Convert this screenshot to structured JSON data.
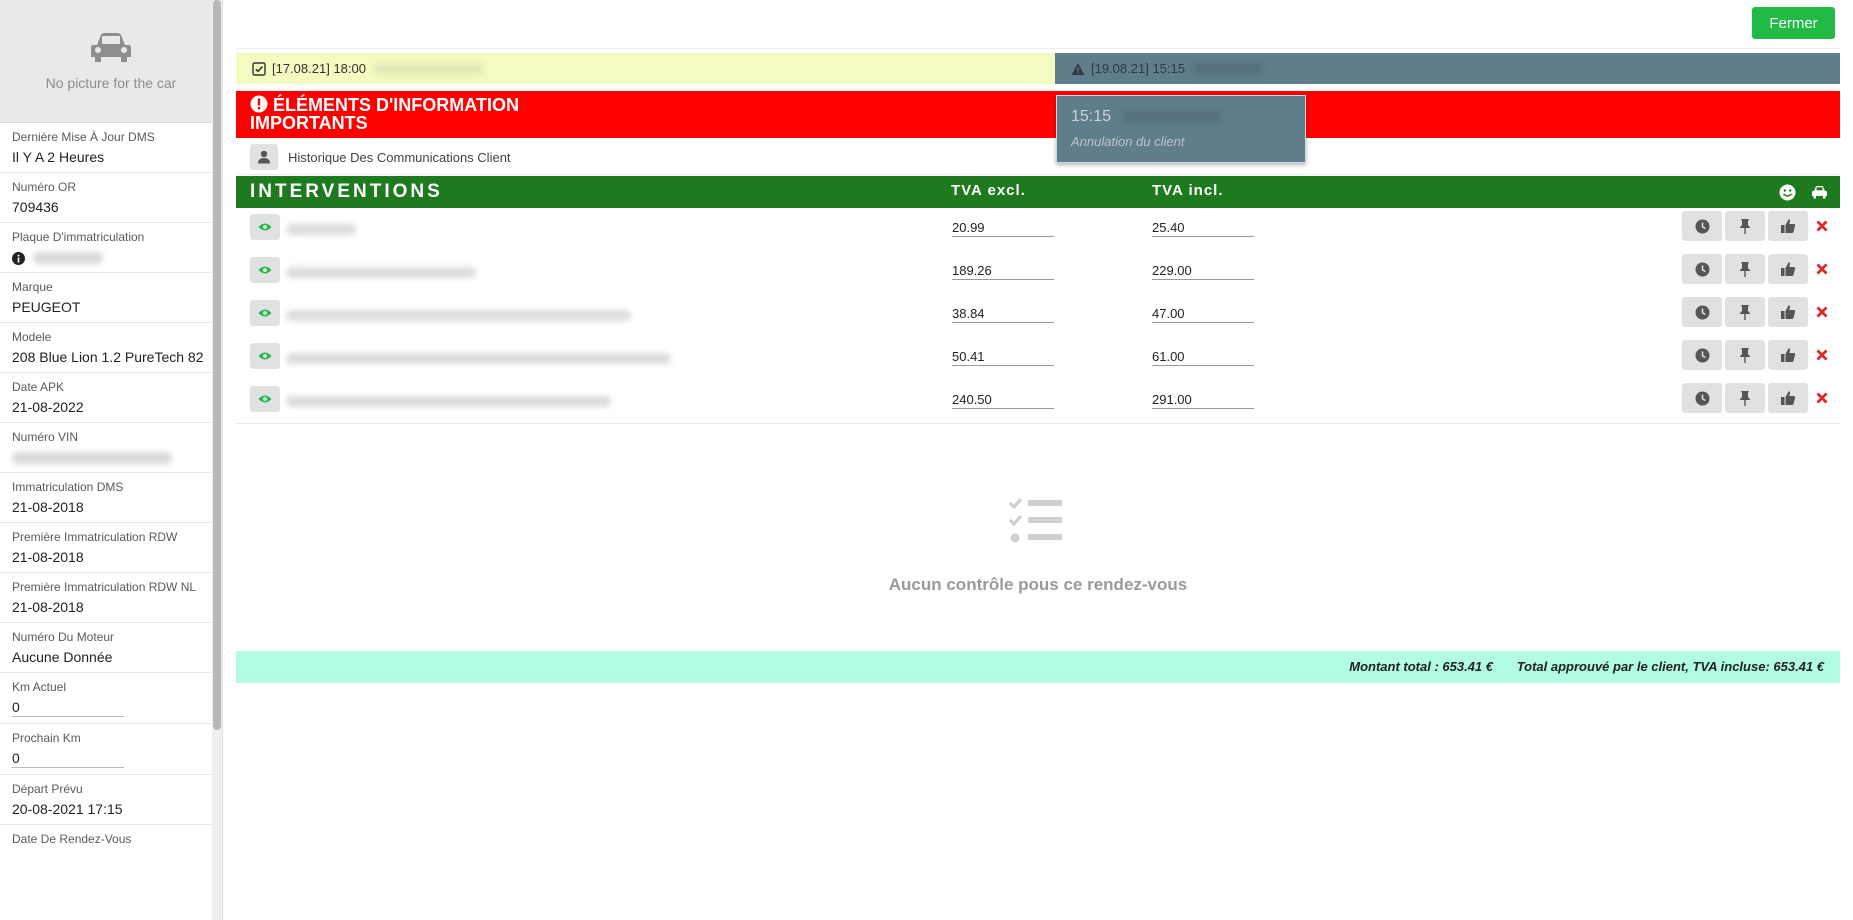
{
  "sidebar": {
    "no_picture": "No picture for the car",
    "fields": {
      "last_update_label": "Dernière Mise À Jour DMS",
      "last_update_value": "Il Y A 2 Heures",
      "or_label": "Numéro OR",
      "or_value": "709436",
      "plate_label": "Plaque D'immatriculation",
      "brand_label": "Marque",
      "brand_value": "PEUGEOT",
      "model_label": "Modele",
      "model_value": "208 Blue Lion 1.2 PureTech 82",
      "apk_label": "Date APK",
      "apk_value": "21-08-2022",
      "vin_label": "Numéro VIN",
      "dms_reg_label": "Immatriculation DMS",
      "dms_reg_value": "21-08-2018",
      "rdw_label": "Première Immatriculation RDW",
      "rdw_value": "21-08-2018",
      "rdw_nl_label": "Première Immatriculation RDW NL",
      "rdw_nl_value": "21-08-2018",
      "engine_label": "Numéro Du Moteur",
      "engine_value": "Aucune Donnée",
      "km_label": "Km Actuel",
      "km_value": "0",
      "next_km_label": "Prochain Km",
      "next_km_value": "0",
      "departure_label": "Départ Prévu",
      "departure_value": "20-08-2021 17:15",
      "appointment_label": "Date De Rendez-Vous"
    }
  },
  "header": {
    "close_label": "Fermer"
  },
  "appointments": {
    "current": "[17.08.21] 18:00",
    "other": "[19.08.21] 15:15"
  },
  "popup": {
    "time": "15:15",
    "subtitle": "Annulation du client"
  },
  "banner": {
    "title": "ÉLÉMENTS D'INFORMATION IMPORTANTS"
  },
  "communications": {
    "label": "Historique Des Communications Client"
  },
  "interventions": {
    "title": "INTERVENTIONS",
    "col_excl": "TVA excl.",
    "col_incl": "TVA incl.",
    "rows": [
      {
        "excl": "20.99",
        "incl": "25.40"
      },
      {
        "excl": "189.26",
        "incl": "229.00"
      },
      {
        "excl": "38.84",
        "incl": "47.00"
      },
      {
        "excl": "50.41",
        "incl": "61.00"
      },
      {
        "excl": "240.50",
        "incl": "291.00"
      }
    ]
  },
  "checks": {
    "empty_text": "Aucun contrôle pous ce rendez-vous"
  },
  "totals": {
    "total": "Montant total : 653.41 €",
    "approved": "Total approuvé par le client, TVA incluse: 653.41 €"
  },
  "colors": {
    "accent_green": "#21ba45",
    "interventions_green": "#1e7a1e",
    "banner_red": "#ff0000",
    "current_appt": "#f4fac0",
    "other_appt": "#607d8b",
    "totals_bg": "#b2fce4",
    "delete_red": "#db2828"
  }
}
